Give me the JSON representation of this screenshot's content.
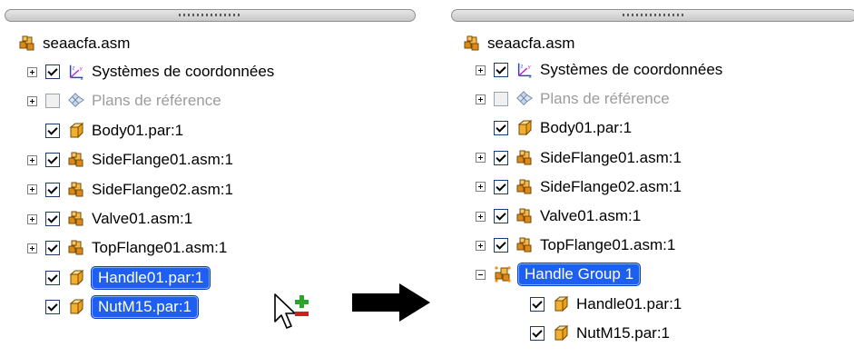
{
  "colors": {
    "selection": "#1e5ef0",
    "asm_icon": "#d98a1a",
    "part_icon": "#e9a21a",
    "plus_green": "#2aa52a",
    "minus_red": "#d21e1e"
  },
  "left_tree": {
    "root": {
      "label": "seaacfa.asm",
      "icon": "assembly-icon"
    },
    "rows": [
      {
        "label": "Systèmes de coordonnées",
        "expander": "plus",
        "checked": true,
        "icon": "coordinate-system-icon"
      },
      {
        "label": "Plans de référence",
        "expander": "plus",
        "checked": false,
        "icon": "reference-plane-icon",
        "dim": true
      },
      {
        "label": "Body01.par:1",
        "expander": "none",
        "checked": true,
        "icon": "part-icon"
      },
      {
        "label": "SideFlange01.asm:1",
        "expander": "plus",
        "checked": true,
        "icon": "assembly-icon"
      },
      {
        "label": "SideFlange02.asm:1",
        "expander": "plus",
        "checked": true,
        "icon": "assembly-icon"
      },
      {
        "label": "Valve01.asm:1",
        "expander": "plus",
        "checked": true,
        "icon": "assembly-icon"
      },
      {
        "label": "TopFlange01.asm:1",
        "expander": "plus",
        "checked": true,
        "icon": "assembly-icon"
      },
      {
        "label": "Handle01.par:1",
        "expander": "none",
        "checked": true,
        "icon": "part-icon",
        "selected": true
      },
      {
        "label": "NutM15.par:1",
        "expander": "none",
        "checked": true,
        "icon": "part-icon",
        "selected": true
      }
    ]
  },
  "right_tree": {
    "root": {
      "label": "seaacfa.asm",
      "icon": "assembly-icon"
    },
    "rows": [
      {
        "label": "Systèmes de coordonnées",
        "expander": "plus",
        "checked": true,
        "icon": "coordinate-system-icon"
      },
      {
        "label": "Plans de référence",
        "expander": "plus",
        "checked": false,
        "icon": "reference-plane-icon",
        "dim": true
      },
      {
        "label": "Body01.par:1",
        "expander": "none",
        "checked": true,
        "icon": "part-icon"
      },
      {
        "label": "SideFlange01.asm:1",
        "expander": "plus",
        "checked": true,
        "icon": "assembly-icon"
      },
      {
        "label": "SideFlange02.asm:1",
        "expander": "plus",
        "checked": true,
        "icon": "assembly-icon"
      },
      {
        "label": "Valve01.asm:1",
        "expander": "plus",
        "checked": true,
        "icon": "assembly-icon"
      },
      {
        "label": "TopFlange01.asm:1",
        "expander": "plus",
        "checked": true,
        "icon": "assembly-icon"
      },
      {
        "label": "Handle Group 1",
        "expander": "minus",
        "icon": "group-icon",
        "selected": true
      },
      {
        "label": "Handle01.par:1",
        "expander": "none",
        "checked": true,
        "icon": "part-icon"
      },
      {
        "label": "NutM15.par:1",
        "expander": "none",
        "checked": true,
        "icon": "part-icon"
      }
    ]
  },
  "transition_arrow": {
    "icon": "right-arrow-icon"
  },
  "cursor": {
    "icon": "drag-cursor-icon",
    "badge": "add-remove-icon"
  }
}
